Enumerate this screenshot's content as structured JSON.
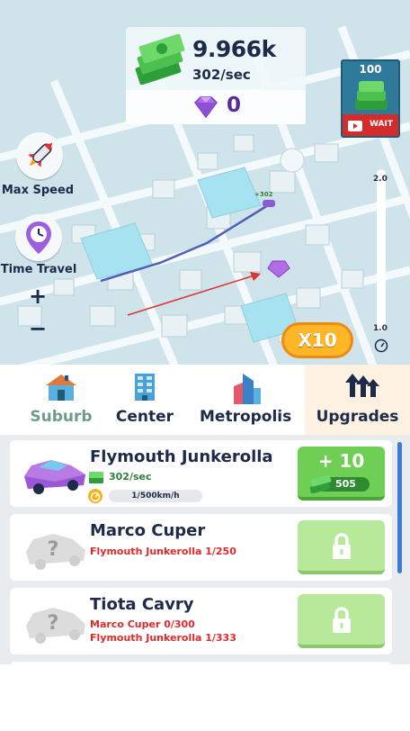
{
  "currency": {
    "cash": "9.966k",
    "rate": "302/sec",
    "gems": "0"
  },
  "ad_reward": {
    "amount": "100",
    "wait_label": "WAIT"
  },
  "side_buttons": {
    "max_speed": "Max Speed",
    "time_travel": "Time Travel",
    "zoom_in": "+",
    "zoom_out": "−"
  },
  "speed_gauge": {
    "max": "2.0",
    "min": "1.0"
  },
  "multiplier_button": "X10",
  "map_tag": "+302",
  "tabs": [
    {
      "label": "Suburb",
      "active": false
    },
    {
      "label": "Center",
      "active": false
    },
    {
      "label": "Metropolis",
      "active": false
    },
    {
      "label": "Upgrades",
      "active": true
    }
  ],
  "cars": [
    {
      "name": "Flymouth Junkerolla",
      "rate": "302/sec",
      "speed": "1/500km/h",
      "upgrade": {
        "plus": "+ 10",
        "cost": "505"
      },
      "locked": false
    },
    {
      "name": "Marco Cuper",
      "requirements": [
        "Flymouth Junkerolla 1/250"
      ],
      "locked": true
    },
    {
      "name": "Tiota Cavry",
      "requirements": [
        "Marco Cuper 0/300",
        "Flymouth Junkerolla 1/333"
      ],
      "locked": true
    }
  ],
  "colors": {
    "text_dark": "#1e2a4a",
    "accent_green": "#6fce54",
    "locked_green": "#b8e89a",
    "requirement_red": "#e02a2a",
    "gem_purple": "#7a3fc8",
    "multiplier_orange": "#ffb627"
  }
}
